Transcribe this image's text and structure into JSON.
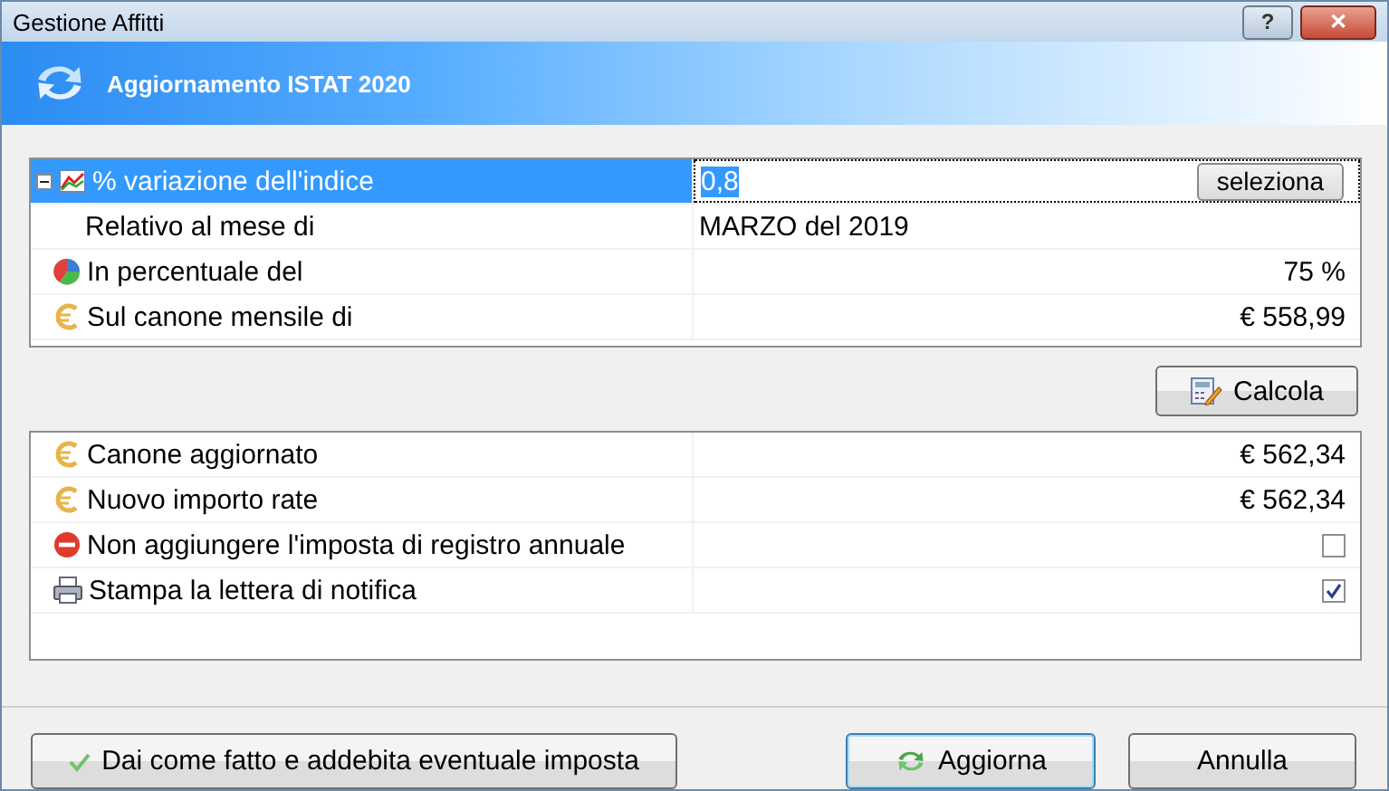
{
  "window": {
    "title": "Gestione Affitti",
    "buttons": [
      "?",
      "✕"
    ]
  },
  "header": {
    "title": "Aggiornamento ISTAT 2020"
  },
  "parameters": [
    {
      "kind": "input",
      "label": "% variazione dell'indice",
      "value": "0,8",
      "button": "seleziona",
      "selected": true,
      "expanded": true
    },
    {
      "kind": "text",
      "label": "Relativo al mese di",
      "value": "MARZO del 2019",
      "selected": false
    },
    {
      "kind": "amount",
      "label": "In percentuale del",
      "value": "75 %",
      "selected": false
    },
    {
      "kind": "amount",
      "label": "Sul canone mensile di",
      "value": "€ 558,99",
      "selected": false
    }
  ],
  "calc_button": "Calcola",
  "results": [
    {
      "kind": "amount",
      "label": "Canone aggiornato",
      "value": "€ 562,34"
    },
    {
      "kind": "amount",
      "label": "Nuovo importo rate",
      "value": "€ 562,34"
    },
    {
      "kind": "check",
      "label": "Non aggiungere l'imposta di registro annuale",
      "checked": false
    },
    {
      "kind": "check",
      "label": "Stampa la lettera di notifica",
      "checked": true
    }
  ],
  "footer": {
    "done_button": "Dai come fatto e addebita eventuale imposta",
    "update_button": "Aggiorna",
    "cancel_button": "Annulla"
  }
}
